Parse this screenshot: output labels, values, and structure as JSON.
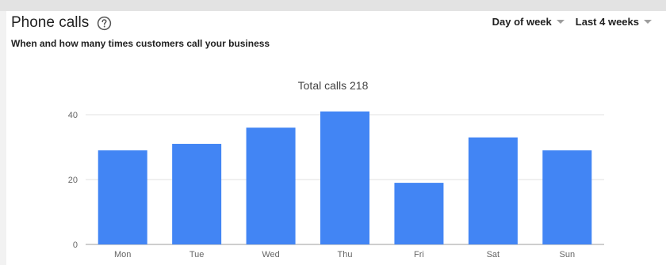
{
  "header": {
    "title": "Phone calls",
    "subtitle": "When and how many times customers call your business",
    "help_icon": "help-circle-icon"
  },
  "filters": {
    "group_by": "Day of week",
    "range": "Last 4 weeks"
  },
  "chart_data": {
    "type": "bar",
    "title": "Total calls 218",
    "categories": [
      "Mon",
      "Tue",
      "Wed",
      "Thu",
      "Fri",
      "Sat",
      "Sun"
    ],
    "values": [
      29,
      31,
      36,
      41,
      19,
      33,
      29
    ],
    "yticks": [
      "0",
      "20",
      "40"
    ],
    "ylim": [
      0,
      45
    ],
    "grid": true,
    "bar_color": "#4285f4",
    "grid_color": "#e0e0e0"
  }
}
